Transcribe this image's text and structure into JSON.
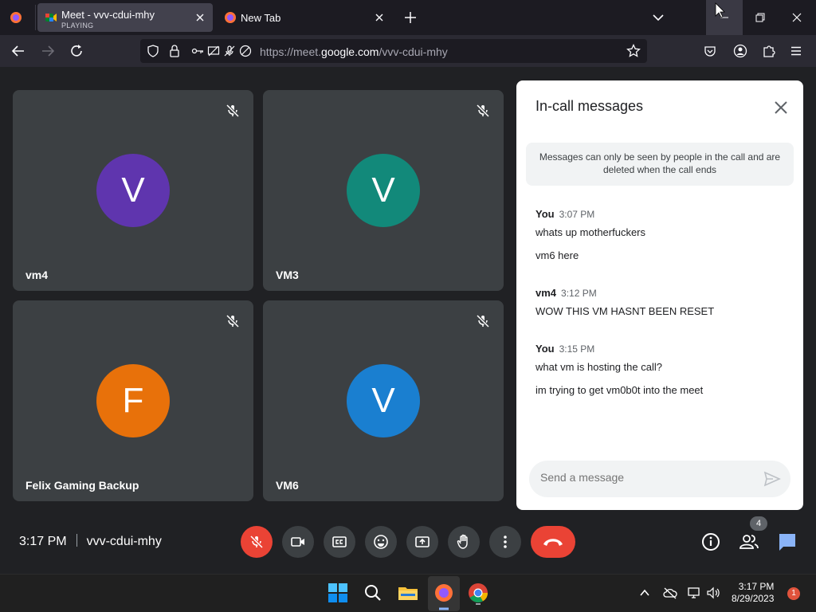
{
  "browser": {
    "tabs": [
      {
        "title": "Meet - vvv-cdui-mhy",
        "subtitle": "PLAYING",
        "active": true
      },
      {
        "title": "New Tab",
        "active": false
      }
    ],
    "url": {
      "prefix": "https://meet.",
      "host": "google.com",
      "path": "/vvv-cdui-mhy"
    }
  },
  "meet": {
    "tiles": [
      {
        "name": "vm4",
        "initial": "V",
        "color": "#5f35ae"
      },
      {
        "name": "VM3",
        "initial": "V",
        "color": "#12897a"
      },
      {
        "name": "Felix Gaming Backup",
        "initial": "F",
        "color": "#e8710a"
      },
      {
        "name": "VM6",
        "initial": "V",
        "color": "#1a7fd0"
      }
    ],
    "time": "3:17 PM",
    "meeting_code": "vvv-cdui-mhy",
    "people_count": "4"
  },
  "chat": {
    "title": "In-call messages",
    "notice": "Messages can only be seen by people in the call and are deleted when the call ends",
    "groups": [
      {
        "sender": "You",
        "time": "3:07 PM",
        "messages": [
          "whats up motherfuckers",
          "vm6 here"
        ]
      },
      {
        "sender": "vm4",
        "time": "3:12 PM",
        "messages": [
          "WOW THIS VM HASNT BEEN RESET"
        ]
      },
      {
        "sender": "You",
        "time": "3:15 PM",
        "messages": [
          "what vm is hosting the call?",
          "im trying to get vm0b0t into the meet"
        ]
      }
    ],
    "input_placeholder": "Send a message"
  },
  "taskbar": {
    "time": "3:17 PM",
    "date": "8/29/2023",
    "notifications": "1"
  }
}
